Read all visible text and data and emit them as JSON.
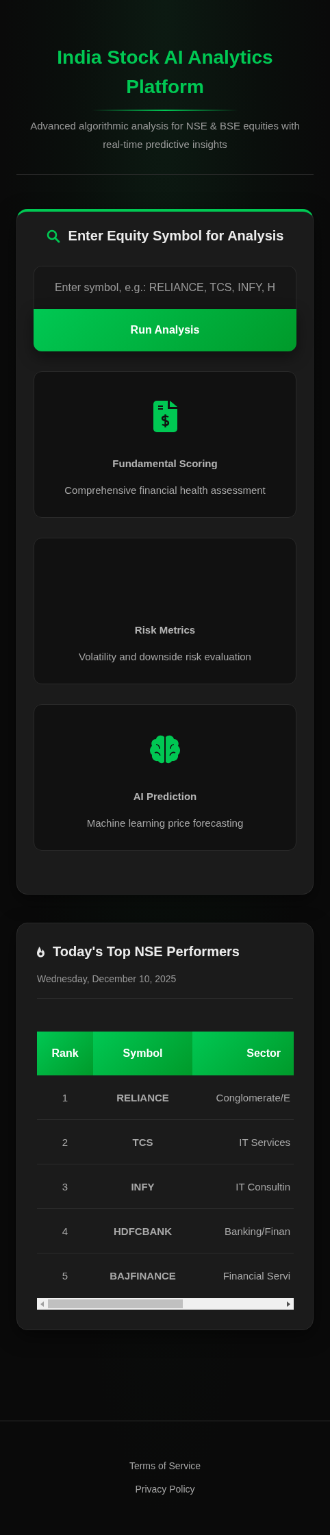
{
  "header": {
    "title": "India Stock AI Analytics Platform",
    "subtitle": "Advanced algorithmic analysis for NSE & BSE equities with real-time predictive insights"
  },
  "analysis": {
    "heading": "Enter Equity Symbol for Analysis",
    "input": {
      "placeholder": "Enter symbol, e.g.: RELIANCE, TCS, INFY, H"
    },
    "button": "Run Analysis",
    "features": [
      {
        "kind": "document",
        "title": "Fundamental Scoring",
        "description": "Comprehensive financial health assessment"
      },
      {
        "kind": "blank",
        "title": "Risk Metrics",
        "description": "Volatility and downside risk evaluation"
      },
      {
        "kind": "brain",
        "title": "AI Prediction",
        "description": "Machine learning price forecasting"
      }
    ]
  },
  "performers": {
    "heading": "Today's Top NSE Performers",
    "date": "Wednesday, December 10, 2025",
    "columns": [
      "Rank",
      "Symbol",
      "Sector"
    ],
    "rows": [
      {
        "rank": "1",
        "symbol": "RELIANCE",
        "sector": "Conglomerate/E"
      },
      {
        "rank": "2",
        "symbol": "TCS",
        "sector": "IT Services"
      },
      {
        "rank": "3",
        "symbol": "INFY",
        "sector": "IT Consultin"
      },
      {
        "rank": "4",
        "symbol": "HDFCBANK",
        "sector": "Banking/Finan"
      },
      {
        "rank": "5",
        "symbol": "BAJFINANCE",
        "sector": "Financial Servi"
      }
    ]
  },
  "footer": {
    "links": [
      "Terms of Service",
      "Privacy Policy"
    ]
  }
}
